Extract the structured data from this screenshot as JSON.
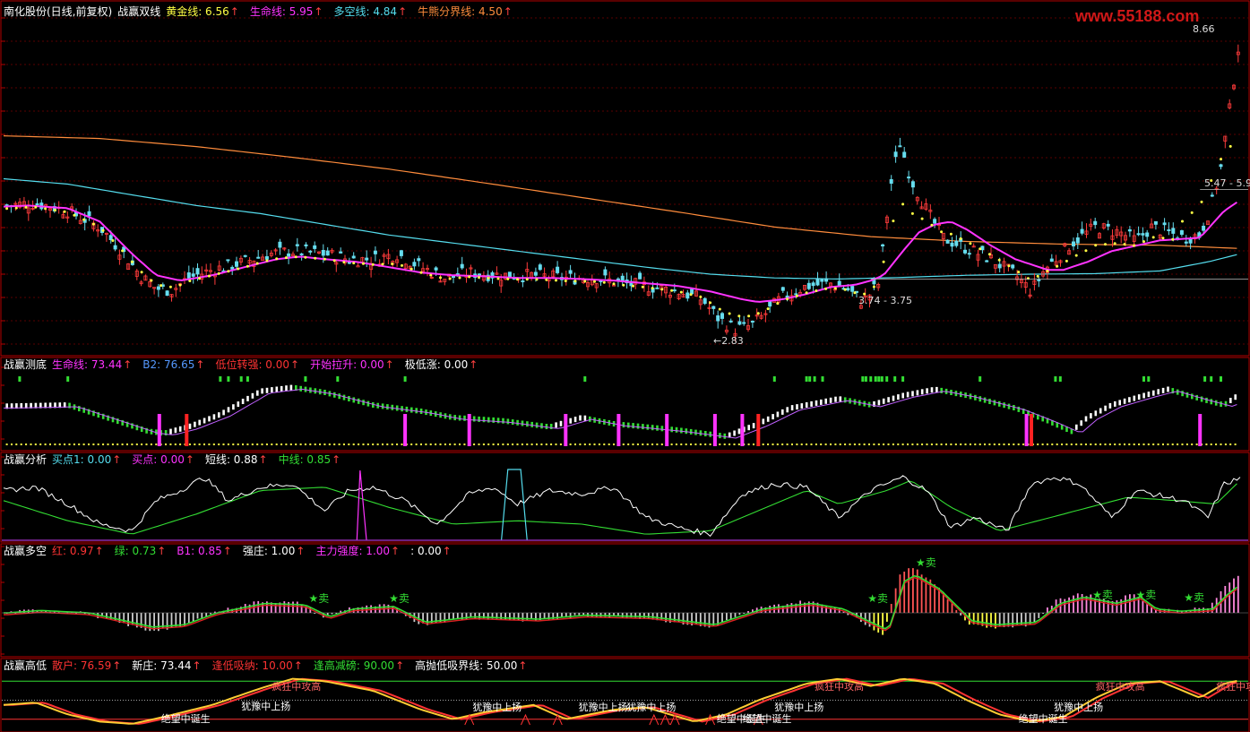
{
  "colors": {
    "bg": "#000000",
    "frame": "#b40000",
    "grid": "#5a0000",
    "white": "#ffffff",
    "magenta": "#ff33ff",
    "yellow": "#ffff44",
    "cyan": "#55ddee",
    "green": "#33dd33",
    "red": "#ff2222",
    "orange": "#ff8c3c",
    "pink": "#ff88dd",
    "blue": "#5599ff"
  },
  "watermark": "www.55188.com",
  "panel1": {
    "stock": "南化股份(日线,前复权)",
    "indicator": "战赢双线",
    "items": [
      {
        "label": "黄金线:",
        "value": "6.56",
        "color": "#ffff44"
      },
      {
        "label": "生命线:",
        "value": "5.95",
        "color": "#ff33ff"
      },
      {
        "label": "多空线:",
        "value": "4.84",
        "color": "#55ddee"
      },
      {
        "label": "牛熊分界线:",
        "value": "4.50",
        "color": "#ff8c3c"
      }
    ],
    "annotations": [
      "8.66",
      "5.47 - 5.9",
      "3.74 - 3.75",
      "←2.83"
    ]
  },
  "panel2": {
    "title": "战赢测底",
    "items": [
      {
        "label": "生命线:",
        "value": "73.44",
        "color": "#ff33ff"
      },
      {
        "label": "B2:",
        "value": "76.65",
        "color": "#5599ff"
      },
      {
        "label": "低位转强:",
        "value": "0.00",
        "color": "#ff3333"
      },
      {
        "label": "开始拉升:",
        "value": "0.00",
        "color": "#ff33ff"
      },
      {
        "label": "极低涨:",
        "value": "0.00",
        "color": "#ffffff"
      }
    ]
  },
  "panel3": {
    "title": "战赢分析",
    "items": [
      {
        "label": "买点1:",
        "value": "0.00",
        "color": "#55ddee"
      },
      {
        "label": "买点:",
        "value": "0.00",
        "color": "#ff33ff"
      },
      {
        "label": "短线:",
        "value": "0.88",
        "color": "#ffffff"
      },
      {
        "label": "中线:",
        "value": "0.85",
        "color": "#33dd33"
      }
    ]
  },
  "panel4": {
    "title": "战赢多空",
    "items": [
      {
        "label": "红:",
        "value": "0.97",
        "color": "#ff3333"
      },
      {
        "label": "绿:",
        "value": "0.73",
        "color": "#33dd33"
      },
      {
        "label": "B1:",
        "value": "0.85",
        "color": "#ff33ff"
      },
      {
        "label": "强庄:",
        "value": "1.00",
        "color": "#ffffff"
      },
      {
        "label": "主力强度:",
        "value": "1.00",
        "color": "#ff33ff"
      },
      {
        "label": ":",
        "value": "0.00",
        "color": "#ffffff"
      }
    ],
    "signals": [
      "卖",
      "卖",
      "卖",
      "卖",
      "卖",
      "卖",
      "卖"
    ]
  },
  "panel5": {
    "title": "战赢高低",
    "items": [
      {
        "label": "散户:",
        "value": "76.59",
        "color": "#ff3333"
      },
      {
        "label": "新庄:",
        "value": "73.44",
        "color": "#ffffff"
      },
      {
        "label": "逢低吸纳:",
        "value": "10.00",
        "color": "#ff3333"
      },
      {
        "label": "逢高减磅:",
        "value": "90.00",
        "color": "#33dd33"
      },
      {
        "label": "高抛低吸界线:",
        "value": "50.00",
        "color": "#ffffff"
      }
    ],
    "labels": [
      "犹豫中上扬",
      "犹豫中上扬",
      "犹豫中上扬",
      "犹豫中上扬",
      "犹豫中上扬",
      "犹豫中上扬",
      "绝望中诞生",
      "绝望中诞生",
      "绝望中诞生",
      "绝望中诞生",
      "疯狂中攻高",
      "疯狂中攻高",
      "疯狂中攻高",
      "疯狂中攻高"
    ]
  },
  "chart_data": {
    "type": "line",
    "x_count": 240,
    "series": [
      {
        "name": "生命线",
        "keys": [
          [
            0,
            5.28
          ],
          [
            15,
            5.3
          ],
          [
            40,
            5.25
          ],
          [
            60,
            5.0
          ],
          [
            80,
            4.4
          ],
          [
            95,
            4.0
          ],
          [
            110,
            3.9
          ],
          [
            130,
            4.0
          ],
          [
            150,
            4.15
          ],
          [
            170,
            4.3
          ],
          [
            185,
            4.35
          ],
          [
            200,
            4.3
          ],
          [
            220,
            4.25
          ],
          [
            240,
            4.15
          ],
          [
            260,
            4.05
          ],
          [
            280,
            4.0
          ],
          [
            300,
            3.98
          ],
          [
            320,
            3.95
          ],
          [
            340,
            3.95
          ],
          [
            360,
            3.93
          ],
          [
            380,
            3.9
          ],
          [
            400,
            3.85
          ],
          [
            420,
            3.8
          ],
          [
            440,
            3.7
          ],
          [
            460,
            3.55
          ],
          [
            470,
            3.5
          ],
          [
            485,
            3.55
          ],
          [
            500,
            3.65
          ],
          [
            515,
            3.78
          ],
          [
            530,
            3.82
          ],
          [
            540,
            3.9
          ],
          [
            548,
            4.0
          ],
          [
            560,
            4.45
          ],
          [
            570,
            4.8
          ],
          [
            580,
            4.95
          ],
          [
            590,
            5.0
          ],
          [
            600,
            4.85
          ],
          [
            615,
            4.55
          ],
          [
            630,
            4.3
          ],
          [
            650,
            4.1
          ],
          [
            660,
            4.1
          ],
          [
            675,
            4.25
          ],
          [
            690,
            4.45
          ],
          [
            705,
            4.55
          ],
          [
            720,
            4.65
          ],
          [
            735,
            4.68
          ],
          [
            745,
            4.7
          ],
          [
            760,
            5.2
          ],
          [
            770,
            5.4
          ]
        ]
      },
      {
        "name": "多空线",
        "keys": [
          [
            0,
            5.8
          ],
          [
            40,
            5.7
          ],
          [
            80,
            5.5
          ],
          [
            120,
            5.3
          ],
          [
            160,
            5.15
          ],
          [
            200,
            4.95
          ],
          [
            240,
            4.75
          ],
          [
            280,
            4.6
          ],
          [
            320,
            4.45
          ],
          [
            360,
            4.3
          ],
          [
            400,
            4.15
          ],
          [
            440,
            4.02
          ],
          [
            480,
            3.95
          ],
          [
            520,
            3.93
          ],
          [
            560,
            3.96
          ],
          [
            600,
            4.0
          ],
          [
            640,
            4.02
          ],
          [
            680,
            4.03
          ],
          [
            720,
            4.08
          ],
          [
            750,
            4.25
          ],
          [
            770,
            4.4
          ]
        ]
      },
      {
        "name": "牛熊分界线",
        "keys": [
          [
            0,
            6.6
          ],
          [
            60,
            6.55
          ],
          [
            120,
            6.4
          ],
          [
            180,
            6.2
          ],
          [
            240,
            5.98
          ],
          [
            300,
            5.72
          ],
          [
            360,
            5.45
          ],
          [
            420,
            5.18
          ],
          [
            480,
            4.9
          ],
          [
            540,
            4.72
          ],
          [
            600,
            4.63
          ],
          [
            660,
            4.58
          ],
          [
            720,
            4.56
          ],
          [
            770,
            4.5
          ]
        ]
      }
    ],
    "ylim": [
      2.7,
      8.8
    ]
  }
}
